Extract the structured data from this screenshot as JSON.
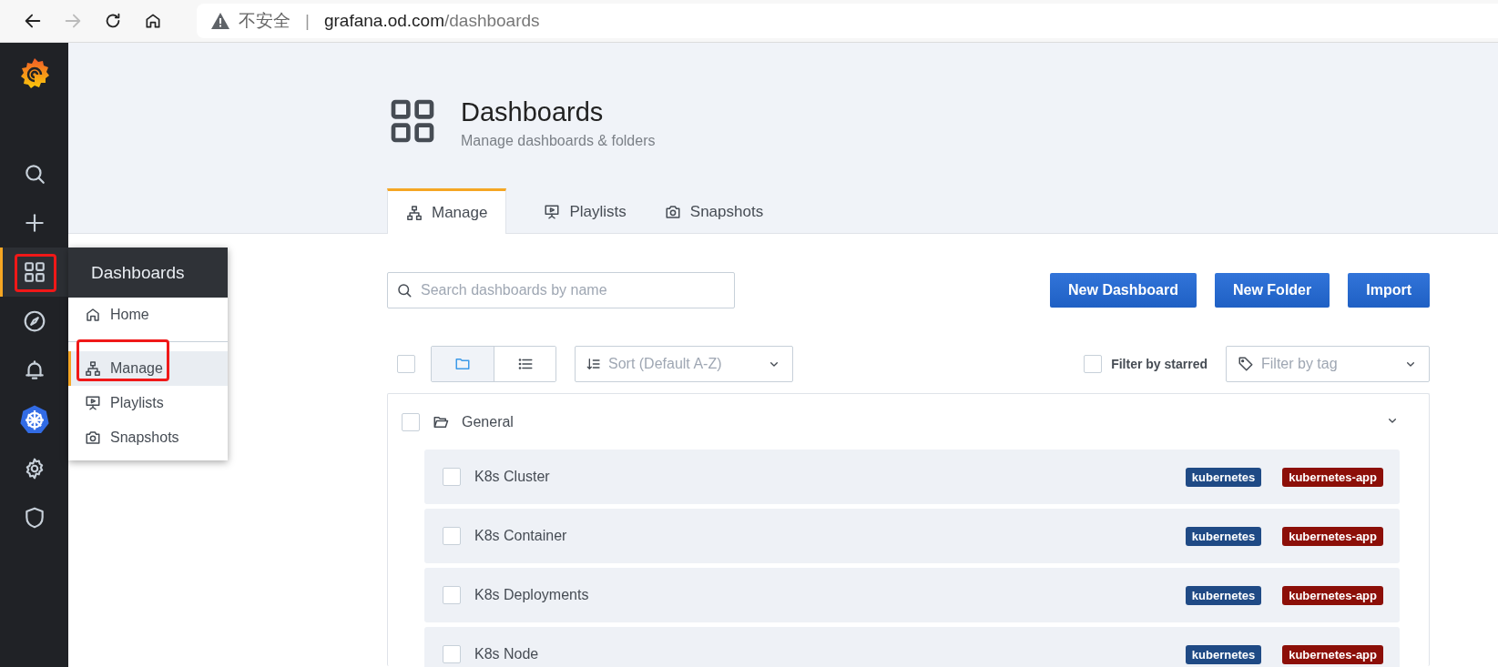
{
  "browser": {
    "warning": "不安全",
    "separator": "|",
    "host": "grafana.od.com",
    "path": "/dashboards"
  },
  "sidebar": {
    "items": [
      {
        "kind": "search",
        "selected": false
      },
      {
        "kind": "create",
        "selected": false
      },
      {
        "kind": "dashboards",
        "selected": true
      },
      {
        "kind": "explore",
        "selected": false
      },
      {
        "kind": "alerting",
        "selected": false
      },
      {
        "kind": "kubernetes",
        "selected": false
      },
      {
        "kind": "settings",
        "selected": false
      },
      {
        "kind": "admin",
        "selected": false
      }
    ]
  },
  "flyout": {
    "title": "Dashboards",
    "items": [
      {
        "kind": "home",
        "label": "Home",
        "selected": false
      },
      {
        "kind": "manage",
        "label": "Manage",
        "selected": true
      },
      {
        "kind": "playlists",
        "label": "Playlists",
        "selected": false
      },
      {
        "kind": "snapshots",
        "label": "Snapshots",
        "selected": false
      }
    ]
  },
  "header": {
    "title": "Dashboards",
    "subtitle": "Manage dashboards & folders"
  },
  "tabs": [
    {
      "kind": "manage",
      "label": "Manage",
      "selected": true
    },
    {
      "kind": "playlists",
      "label": "Playlists",
      "selected": false
    },
    {
      "kind": "snapshots",
      "label": "Snapshots",
      "selected": false
    }
  ],
  "search": {
    "placeholder": "Search dashboards by name"
  },
  "buttons": [
    "New Dashboard",
    "New Folder",
    "Import"
  ],
  "toolbar": {
    "select_all_checked": false,
    "view_modes": [
      {
        "kind": "folders",
        "selected": true
      },
      {
        "kind": "list",
        "selected": false
      }
    ],
    "sort": {
      "placeholder": "Sort (Default A-Z)"
    },
    "starred_filter": {
      "label": "Filter by starred",
      "checked": false
    },
    "tag_filter": {
      "placeholder": "Filter by tag"
    }
  },
  "folder": {
    "name": "General",
    "checked": false,
    "expanded": true,
    "dashboards": [
      {
        "title": "K8s Cluster",
        "checked": false,
        "tags": [
          {
            "label": "kubernetes",
            "color": "#1f4a85"
          },
          {
            "label": "kubernetes-app",
            "color": "#8c0f08"
          }
        ]
      },
      {
        "title": "K8s Container",
        "checked": false,
        "tags": [
          {
            "label": "kubernetes",
            "color": "#1f4a85"
          },
          {
            "label": "kubernetes-app",
            "color": "#8c0f08"
          }
        ]
      },
      {
        "title": "K8s Deployments",
        "checked": false,
        "tags": [
          {
            "label": "kubernetes",
            "color": "#1f4a85"
          },
          {
            "label": "kubernetes-app",
            "color": "#8c0f08"
          }
        ]
      },
      {
        "title": "K8s Node",
        "checked": false,
        "tags": [
          {
            "label": "kubernetes",
            "color": "#1f4a85"
          },
          {
            "label": "kubernetes-app",
            "color": "#8c0f08"
          }
        ]
      }
    ]
  }
}
